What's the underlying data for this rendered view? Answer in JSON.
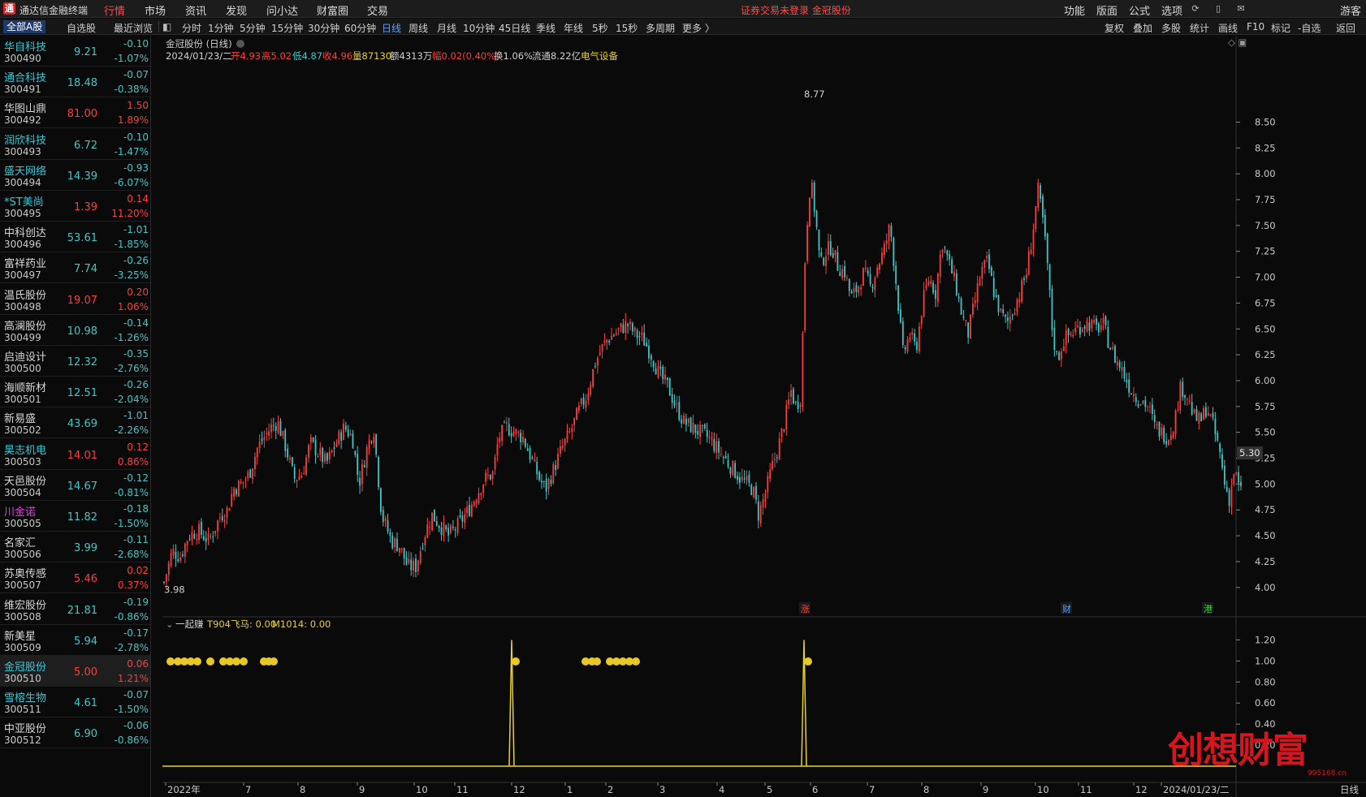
{
  "menubar": {
    "app_title": "通达信金融终端",
    "menus": [
      "行情",
      "市场",
      "资讯",
      "发现",
      "问小达",
      "财富圈",
      "交易"
    ],
    "warning": "证券交易未登录  金冠股份",
    "right_menus": [
      "功能",
      "版面",
      "公式",
      "选项"
    ],
    "user": "游客"
  },
  "tabs": [
    "全部A股",
    "自选股",
    "最近浏览"
  ],
  "periods": [
    "分时",
    "1分钟",
    "5分钟",
    "15分钟",
    "30分钟",
    "60分钟",
    "日线",
    "周线",
    "月线",
    "10分钟",
    "45日线",
    "季线",
    "年线",
    "5秒",
    "15秒",
    "多周期",
    "更多 〉"
  ],
  "active_period": "日线",
  "right_tools": [
    "复权",
    "叠加",
    "多股",
    "统计",
    "画线",
    "F10",
    "标记",
    "-自选",
    "返回"
  ],
  "stocks": [
    {
      "name": "华自科技",
      "code": "300490",
      "price": "9.21",
      "chg": "-0.10",
      "pct": "-1.07%",
      "dir": "down",
      "nc": "cyan"
    },
    {
      "name": "通合科技",
      "code": "300491",
      "price": "18.48",
      "chg": "-0.07",
      "pct": "-0.38%",
      "dir": "down",
      "nc": "cyan"
    },
    {
      "name": "华图山鼎",
      "code": "300492",
      "price": "81.00",
      "chg": "1.50",
      "pct": "1.89%",
      "dir": "up",
      "nc": "white"
    },
    {
      "name": "润欣科技",
      "code": "300493",
      "price": "6.72",
      "chg": "-0.10",
      "pct": "-1.47%",
      "dir": "down",
      "nc": "cyan"
    },
    {
      "name": "盛天网络",
      "code": "300494",
      "price": "14.39",
      "chg": "-0.93",
      "pct": "-6.07%",
      "dir": "down",
      "nc": "cyan"
    },
    {
      "name": "*ST美尚",
      "code": "300495",
      "price": "1.39",
      "chg": "0.14",
      "pct": "11.20%",
      "dir": "up",
      "nc": "cyan"
    },
    {
      "name": "中科创达",
      "code": "300496",
      "price": "53.61",
      "chg": "-1.01",
      "pct": "-1.85%",
      "dir": "down",
      "nc": "white"
    },
    {
      "name": "富祥药业",
      "code": "300497",
      "price": "7.74",
      "chg": "-0.26",
      "pct": "-3.25%",
      "dir": "down",
      "nc": "white"
    },
    {
      "name": "温氏股份",
      "code": "300498",
      "price": "19.07",
      "chg": "0.20",
      "pct": "1.06%",
      "dir": "up",
      "nc": "white"
    },
    {
      "name": "高澜股份",
      "code": "300499",
      "price": "10.98",
      "chg": "-0.14",
      "pct": "-1.26%",
      "dir": "down",
      "nc": "white"
    },
    {
      "name": "启迪设计",
      "code": "300500",
      "price": "12.32",
      "chg": "-0.35",
      "pct": "-2.76%",
      "dir": "down",
      "nc": "white"
    },
    {
      "name": "海顺新材",
      "code": "300501",
      "price": "12.51",
      "chg": "-0.26",
      "pct": "-2.04%",
      "dir": "down",
      "nc": "white"
    },
    {
      "name": "新易盛",
      "code": "300502",
      "price": "43.69",
      "chg": "-1.01",
      "pct": "-2.26%",
      "dir": "down",
      "nc": "white"
    },
    {
      "name": "昊志机电",
      "code": "300503",
      "price": "14.01",
      "chg": "0.12",
      "pct": "0.86%",
      "dir": "up",
      "nc": "cyan"
    },
    {
      "name": "天邑股份",
      "code": "300504",
      "price": "14.67",
      "chg": "-0.12",
      "pct": "-0.81%",
      "dir": "down",
      "nc": "white"
    },
    {
      "name": "川金诺",
      "code": "300505",
      "price": "11.82",
      "chg": "-0.18",
      "pct": "-1.50%",
      "dir": "down",
      "nc": "magenta"
    },
    {
      "name": "名家汇",
      "code": "300506",
      "price": "3.99",
      "chg": "-0.11",
      "pct": "-2.68%",
      "dir": "down",
      "nc": "white"
    },
    {
      "name": "苏奥传感",
      "code": "300507",
      "price": "5.46",
      "chg": "0.02",
      "pct": "0.37%",
      "dir": "up",
      "nc": "white"
    },
    {
      "name": "维宏股份",
      "code": "300508",
      "price": "21.81",
      "chg": "-0.19",
      "pct": "-0.86%",
      "dir": "down",
      "nc": "white"
    },
    {
      "name": "新美星",
      "code": "300509",
      "price": "5.94",
      "chg": "-0.17",
      "pct": "-2.78%",
      "dir": "down",
      "nc": "white"
    },
    {
      "name": "金冠股份",
      "code": "300510",
      "price": "5.00",
      "chg": "0.06",
      "pct": "1.21%",
      "dir": "up",
      "nc": "cyan"
    },
    {
      "name": "雪榕生物",
      "code": "300511",
      "price": "4.61",
      "chg": "-0.07",
      "pct": "-1.50%",
      "dir": "down",
      "nc": "cyan"
    },
    {
      "name": "中亚股份",
      "code": "300512",
      "price": "6.90",
      "chg": "-0.06",
      "pct": "-0.86%",
      "dir": "down",
      "nc": "white"
    }
  ],
  "selected_index": 20,
  "chart_header": {
    "title": "金冠股份 (日线)",
    "date": "2024/01/23/二",
    "open": "开4.93",
    "high": "高5.02",
    "low": "低4.87",
    "close": "收4.96",
    "volume": "量87130",
    "amount": "额4313万",
    "range": "幅0.02(0.40%)",
    "turnover": "换1.06%",
    "float_cap": "流通8.22亿",
    "sector": "电气设备"
  },
  "chart_data": {
    "type": "candlestick",
    "y_ticks": [
      "8.50",
      "8.25",
      "8.00",
      "7.75",
      "7.50",
      "7.25",
      "7.00",
      "6.75",
      "6.50",
      "6.25",
      "6.00",
      "5.75",
      "5.50",
      "5.25",
      "5.00",
      "4.75",
      "4.50",
      "4.25",
      "4.00"
    ],
    "ylim": [
      3.92,
      8.88
    ],
    "max_label": "8.77",
    "min_label": "3.98",
    "current_price": "5.30",
    "x_ticks": [
      "2022年",
      "7",
      "8",
      "9",
      "10",
      "11",
      "12",
      "1",
      "2",
      "3",
      "4",
      "5",
      "6",
      "7",
      "8",
      "9",
      "10",
      "11",
      "12",
      "2024/01/23/二"
    ],
    "path": [
      [
        0,
        4.05
      ],
      [
        10,
        4.35
      ],
      [
        20,
        4.3
      ],
      [
        30,
        4.5
      ],
      [
        42,
        4.55
      ],
      [
        55,
        4.45
      ],
      [
        70,
        4.7
      ],
      [
        78,
        4.75
      ],
      [
        85,
        4.95
      ],
      [
        95,
        5.0
      ],
      [
        105,
        5.1
      ],
      [
        115,
        5.35
      ],
      [
        123,
        5.45
      ],
      [
        132,
        5.55
      ],
      [
        140,
        5.6
      ],
      [
        150,
        5.35
      ],
      [
        160,
        5.05
      ],
      [
        170,
        5.1
      ],
      [
        180,
        5.4
      ],
      [
        190,
        5.3
      ],
      [
        200,
        5.2
      ],
      [
        212,
        5.4
      ],
      [
        222,
        5.55
      ],
      [
        232,
        5.45
      ],
      [
        240,
        5.0
      ],
      [
        250,
        5.35
      ],
      [
        258,
        5.55
      ],
      [
        268,
        4.7
      ],
      [
        280,
        4.45
      ],
      [
        290,
        4.4
      ],
      [
        300,
        4.2
      ],
      [
        310,
        4.2
      ],
      [
        320,
        4.5
      ],
      [
        330,
        4.7
      ],
      [
        340,
        4.6
      ],
      [
        350,
        4.5
      ],
      [
        362,
        4.6
      ],
      [
        375,
        4.75
      ],
      [
        385,
        4.9
      ],
      [
        395,
        5.05
      ],
      [
        405,
        5.1
      ],
      [
        412,
        5.45
      ],
      [
        422,
        5.55
      ],
      [
        432,
        5.5
      ],
      [
        442,
        5.45
      ],
      [
        452,
        5.25
      ],
      [
        462,
        5.05
      ],
      [
        470,
        4.95
      ],
      [
        480,
        5.15
      ],
      [
        490,
        5.35
      ],
      [
        500,
        5.5
      ],
      [
        510,
        5.7
      ],
      [
        520,
        5.85
      ],
      [
        530,
        6.15
      ],
      [
        538,
        6.3
      ],
      [
        546,
        6.4
      ],
      [
        554,
        6.45
      ],
      [
        562,
        6.5
      ],
      [
        570,
        6.55
      ],
      [
        580,
        6.45
      ],
      [
        590,
        6.4
      ],
      [
        600,
        6.25
      ],
      [
        610,
        6.05
      ],
      [
        620,
        5.95
      ],
      [
        630,
        5.75
      ],
      [
        640,
        5.6
      ],
      [
        650,
        5.55
      ],
      [
        660,
        5.5
      ],
      [
        670,
        5.45
      ],
      [
        680,
        5.35
      ],
      [
        690,
        5.25
      ],
      [
        700,
        5.15
      ],
      [
        710,
        5.05
      ],
      [
        718,
        5.0
      ],
      [
        725,
        4.95
      ],
      [
        732,
        4.7
      ],
      [
        740,
        4.9
      ],
      [
        748,
        5.15
      ],
      [
        756,
        5.35
      ],
      [
        764,
        5.6
      ],
      [
        772,
        5.9
      ],
      [
        778,
        5.75
      ],
      [
        784,
        5.85
      ],
      [
        790,
        7.35
      ],
      [
        796,
        7.95
      ],
      [
        802,
        7.6
      ],
      [
        808,
        7.1
      ],
      [
        815,
        7.25
      ],
      [
        822,
        7.3
      ],
      [
        830,
        7.1
      ],
      [
        838,
        7.05
      ],
      [
        846,
        6.8
      ],
      [
        854,
        6.9
      ],
      [
        862,
        7.05
      ],
      [
        870,
        6.9
      ],
      [
        878,
        7.1
      ],
      [
        886,
        7.25
      ],
      [
        894,
        7.5
      ],
      [
        902,
        6.9
      ],
      [
        910,
        6.25
      ],
      [
        918,
        6.45
      ],
      [
        926,
        6.3
      ],
      [
        934,
        6.75
      ],
      [
        942,
        7.0
      ],
      [
        950,
        6.85
      ],
      [
        958,
        7.35
      ],
      [
        966,
        7.15
      ],
      [
        974,
        6.95
      ],
      [
        982,
        6.65
      ],
      [
        990,
        6.45
      ],
      [
        998,
        6.75
      ],
      [
        1006,
        7.05
      ],
      [
        1014,
        7.15
      ],
      [
        1022,
        6.85
      ],
      [
        1030,
        6.65
      ],
      [
        1038,
        6.55
      ],
      [
        1046,
        6.7
      ],
      [
        1054,
        6.85
      ],
      [
        1062,
        7.05
      ],
      [
        1070,
        7.45
      ],
      [
        1076,
        7.85
      ],
      [
        1082,
        7.55
      ],
      [
        1088,
        7.1
      ],
      [
        1094,
        6.45
      ],
      [
        1100,
        6.2
      ],
      [
        1108,
        6.4
      ],
      [
        1116,
        6.45
      ],
      [
        1124,
        6.5
      ],
      [
        1132,
        6.55
      ],
      [
        1140,
        6.55
      ],
      [
        1148,
        6.5
      ],
      [
        1156,
        6.55
      ],
      [
        1164,
        6.35
      ],
      [
        1172,
        6.2
      ],
      [
        1180,
        6.1
      ],
      [
        1188,
        5.95
      ],
      [
        1196,
        5.85
      ],
      [
        1204,
        5.8
      ],
      [
        1212,
        5.75
      ],
      [
        1220,
        5.55
      ],
      [
        1228,
        5.5
      ],
      [
        1236,
        5.45
      ],
      [
        1244,
        5.6
      ],
      [
        1252,
        5.95
      ],
      [
        1260,
        5.85
      ],
      [
        1268,
        5.65
      ],
      [
        1276,
        5.6
      ],
      [
        1284,
        5.75
      ],
      [
        1292,
        5.55
      ],
      [
        1300,
        5.3
      ],
      [
        1306,
        5.0
      ],
      [
        1312,
        4.85
      ],
      [
        1318,
        5.15
      ],
      [
        1322,
        5.0
      ],
      [
        1326,
        4.92
      ]
    ],
    "tags": [
      "涨",
      "财",
      "港"
    ],
    "indicator_title": "一起赚",
    "indicator_vals": "T904飞马: 0.00",
    "indicator_vals2": "M1014: 0.00",
    "ind_ticks": [
      "1.20",
      "1.00",
      "0.80",
      "0.60",
      "0.40",
      "0.20"
    ],
    "ind_ylim": [
      0,
      1.25
    ],
    "spikes": [
      {
        "x": 430,
        "v": 1.2
      },
      {
        "x": 790,
        "v": 1.2
      }
    ],
    "coin_xs": [
      5,
      14,
      22,
      30,
      38,
      54,
      70,
      78,
      86,
      95,
      120,
      126,
      132,
      430,
      516,
      524,
      530,
      546,
      554,
      562,
      570,
      578,
      790
    ]
  },
  "watermark": {
    "main": "创想财富",
    "sub": "995168.cn"
  },
  "colors": {
    "up": "#ff3c3c",
    "down": "#3cc8c8",
    "cyan": "#35c9d8",
    "gold": "#e8d028",
    "axis": "#c8c8c8",
    "grid": "#333333"
  }
}
